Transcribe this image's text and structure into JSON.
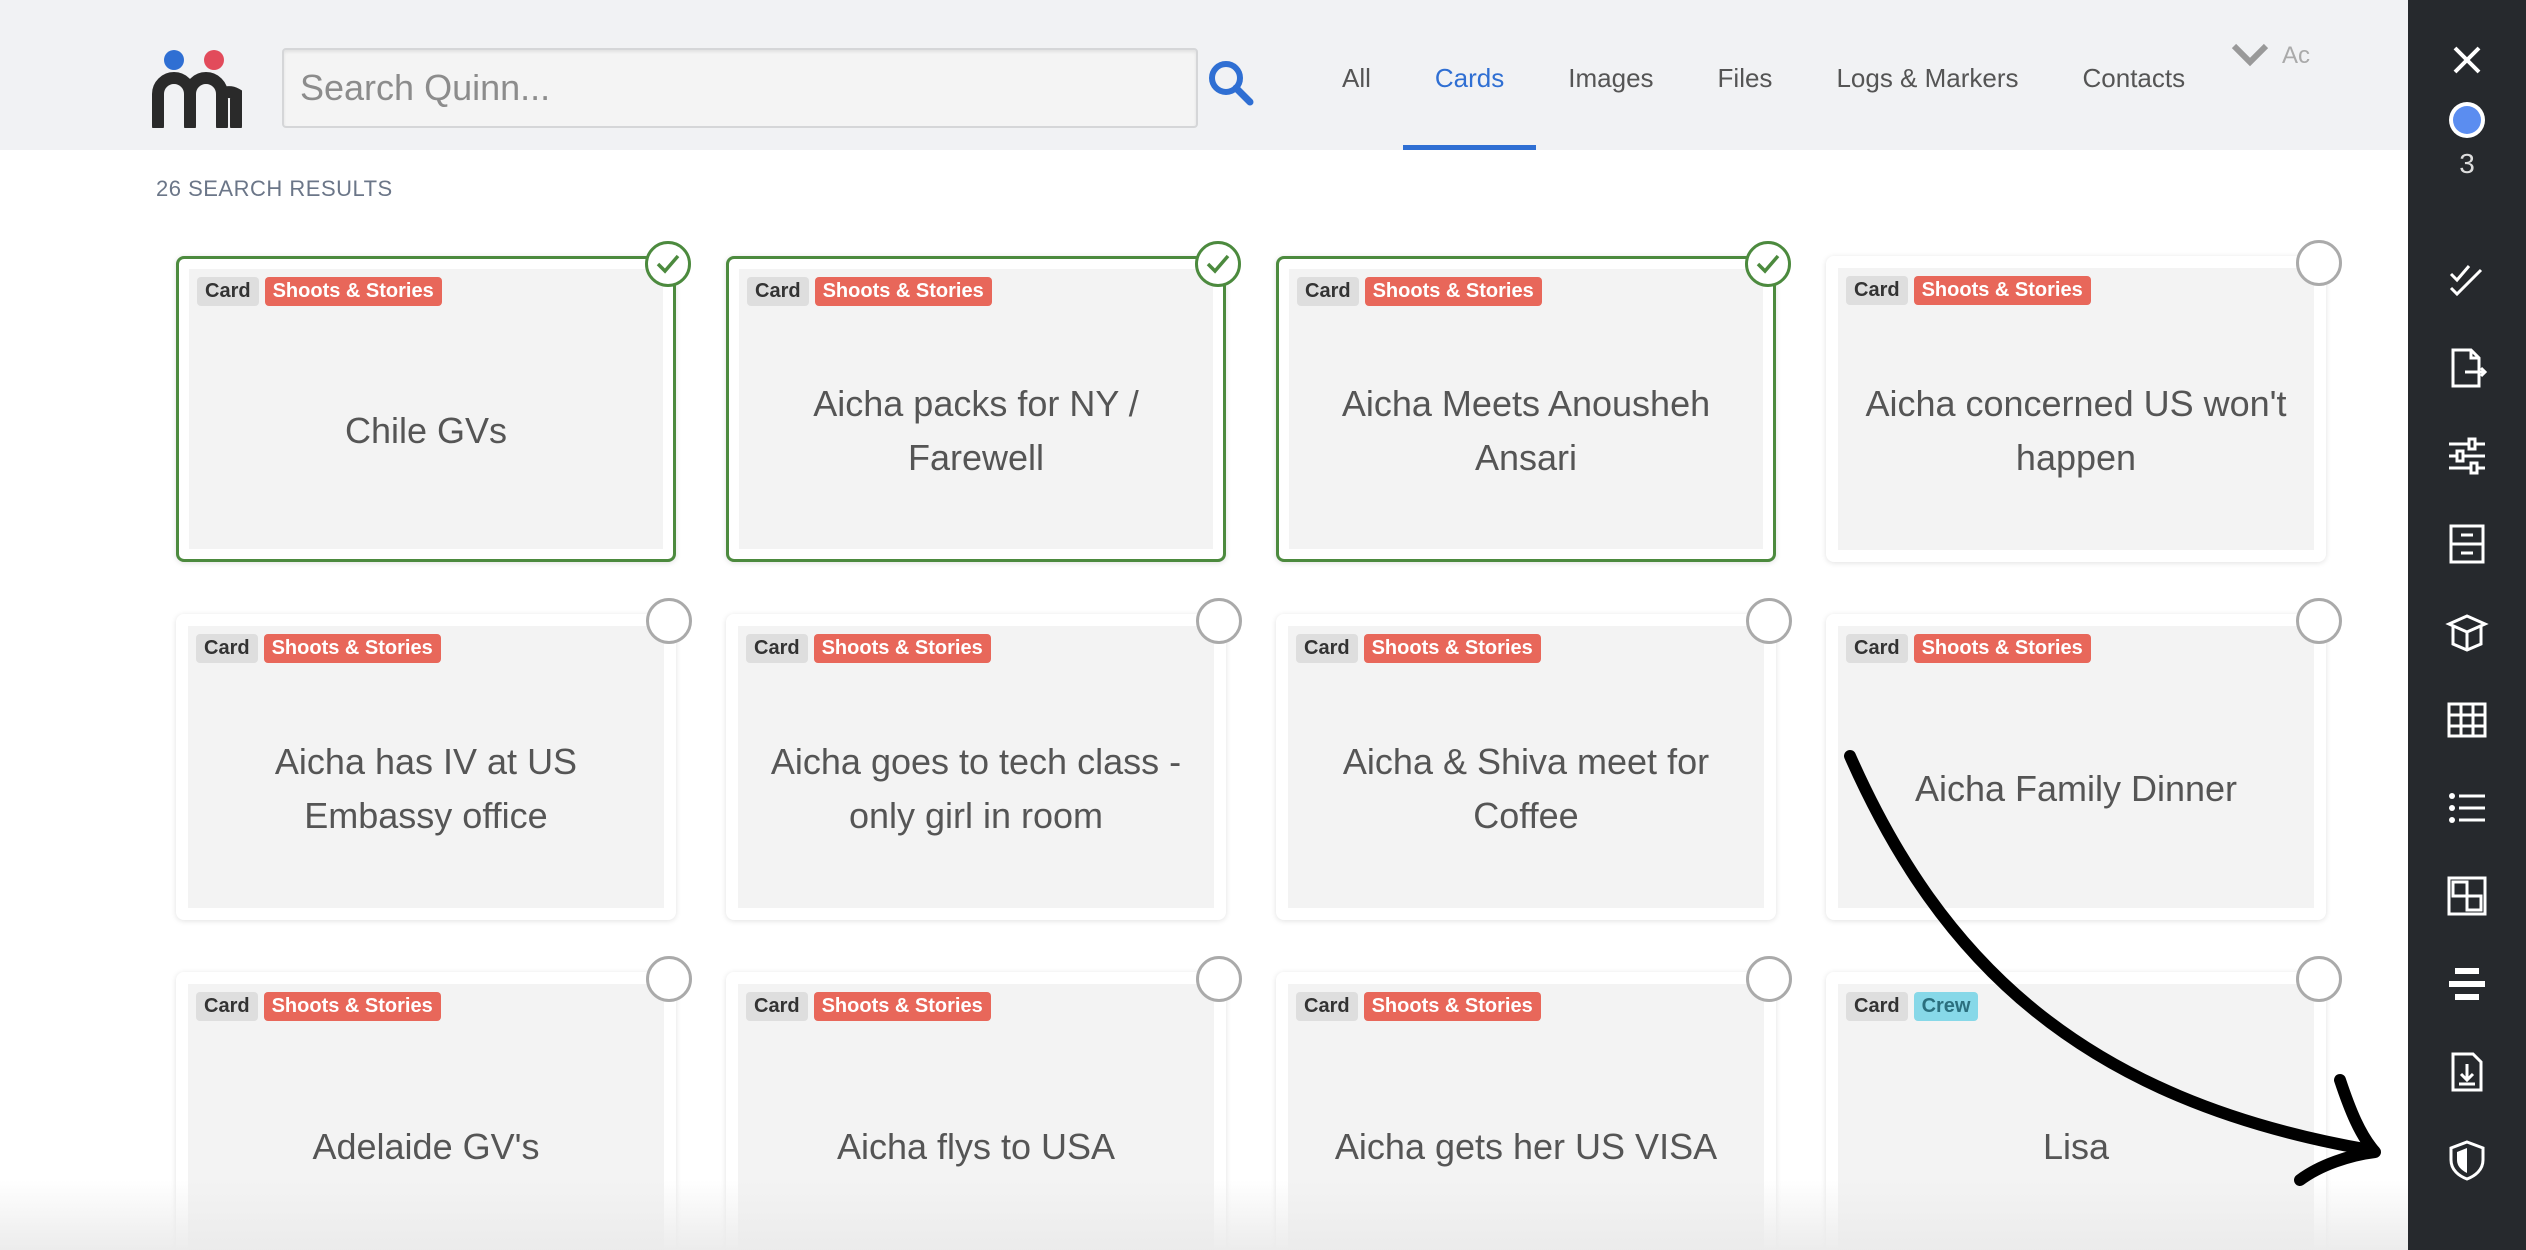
{
  "search": {
    "placeholder": "Search Quinn..."
  },
  "tabs": [
    {
      "label": "All",
      "active": false
    },
    {
      "label": "Cards",
      "active": true
    },
    {
      "label": "Images",
      "active": false
    },
    {
      "label": "Files",
      "active": false
    },
    {
      "label": "Logs & Markers",
      "active": false
    },
    {
      "label": "Contacts",
      "active": false
    }
  ],
  "account_text": "Ac",
  "results_count": "26 SEARCH RESULTS",
  "selected_count": "3",
  "colors": {
    "accent": "#2f6fd3",
    "selected_border": "#4c8a3e",
    "tag_shoots": "#e8675a",
    "tag_crew": "#87d8e8",
    "sidebar_bg": "#26292d"
  },
  "cards": [
    {
      "type": "Card",
      "tag": "Shoots & Stories",
      "title": "Chile GVs",
      "selected": true
    },
    {
      "type": "Card",
      "tag": "Shoots & Stories",
      "title": "Aicha packs for NY / Farewell",
      "selected": true
    },
    {
      "type": "Card",
      "tag": "Shoots & Stories",
      "title": "Aicha Meets Anousheh Ansari",
      "selected": true
    },
    {
      "type": "Card",
      "tag": "Shoots & Stories",
      "title": "Aicha concerned US won't happen",
      "selected": false
    },
    {
      "type": "Card",
      "tag": "Shoots & Stories",
      "title": "Aicha has IV at US Embassy office",
      "selected": false
    },
    {
      "type": "Card",
      "tag": "Shoots & Stories",
      "title": "Aicha goes to tech class - only girl in room",
      "selected": false
    },
    {
      "type": "Card",
      "tag": "Shoots & Stories",
      "title": "Aicha & Shiva meet for Coffee",
      "selected": false
    },
    {
      "type": "Card",
      "tag": "Shoots & Stories",
      "title": "Aicha Family Dinner",
      "selected": false
    },
    {
      "type": "Card",
      "tag": "Shoots & Stories",
      "title": "Adelaide GV's",
      "selected": false
    },
    {
      "type": "Card",
      "tag": "Shoots & Stories",
      "title": "Aicha flys to USA",
      "selected": false
    },
    {
      "type": "Card",
      "tag": "Shoots & Stories",
      "title": "Aicha gets her US VISA",
      "selected": false
    },
    {
      "type": "Card",
      "tag": "Crew",
      "title": "Lisa",
      "selected": false
    }
  ],
  "sidebar_icons": [
    "close-icon",
    "radio-selected-icon",
    "select-all-check-icon",
    "export-document-icon",
    "filter-sliders-icon",
    "archive-drawer-icon",
    "gift-box-icon",
    "grid-view-icon",
    "list-view-icon",
    "board-view-icon",
    "align-lines-icon",
    "download-document-icon",
    "shield-icon"
  ]
}
